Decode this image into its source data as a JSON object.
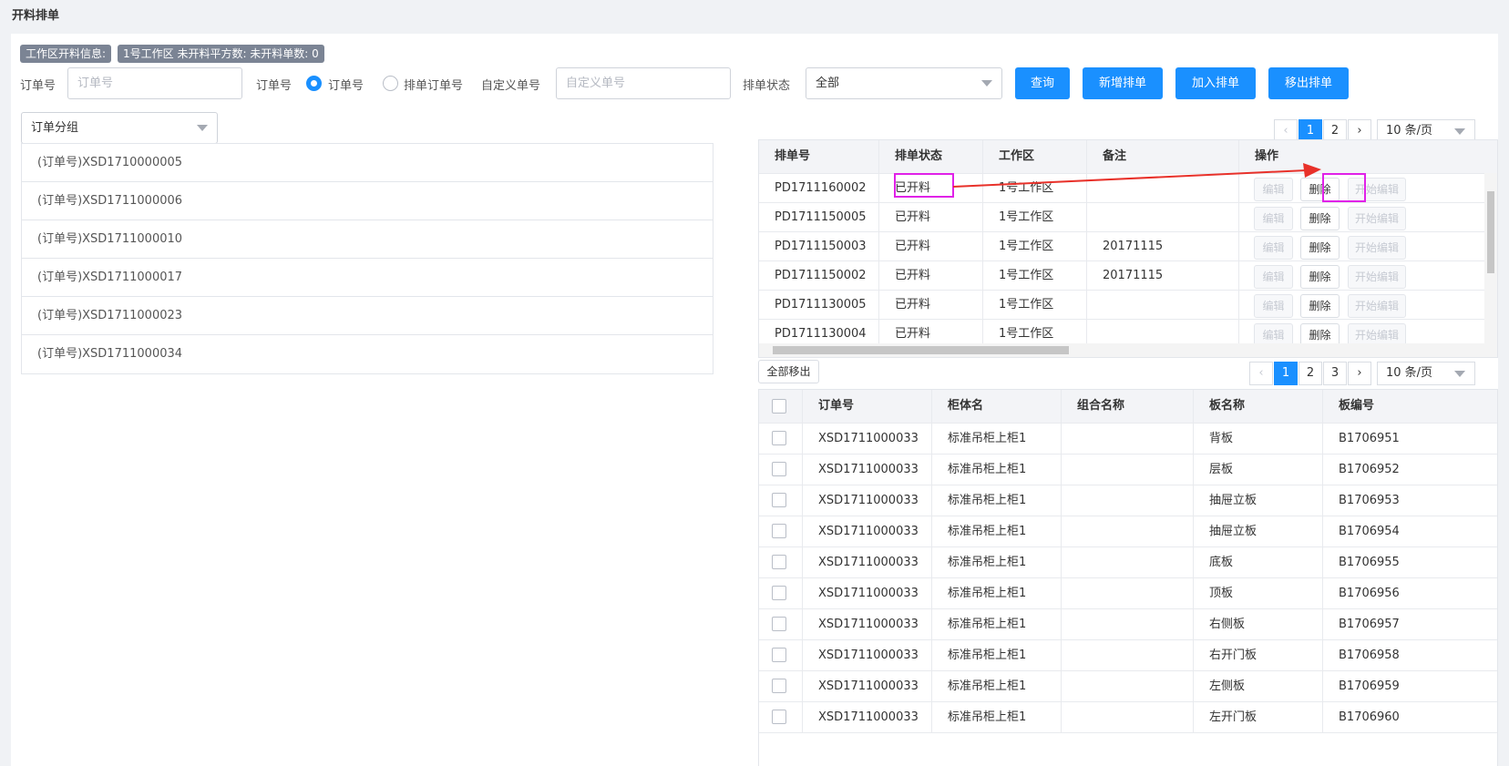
{
  "page": {
    "title": "开料排单"
  },
  "info": {
    "label": "工作区开料信息:",
    "summary": "1号工作区 未开料平方数: 未开料单数: 0"
  },
  "filters": {
    "order_label": "订单号",
    "order_placeholder": "订单号",
    "type_label": "订单号",
    "radio_order": "订单号",
    "radio_schedule": "排单订单号",
    "custom_label": "自定义单号",
    "custom_placeholder": "自定义单号",
    "status_label": "排单状态",
    "status_value": "全部",
    "group_value": "订单分组"
  },
  "buttons": {
    "query": "查询",
    "new_schedule": "新增排单",
    "add": "加入排单",
    "remove": "移出排单",
    "remove_all": "全部移出"
  },
  "orders": [
    "(订单号)XSD1710000005",
    "(订单号)XSD1711000006",
    "(订单号)XSD1711000010",
    "(订单号)XSD1711000017",
    "(订单号)XSD1711000023",
    "(订单号)XSD1711000034"
  ],
  "pager_top": {
    "prev": "‹",
    "pages": [
      "1",
      "2"
    ],
    "next": "›",
    "size": "10 条/页"
  },
  "pager_bottom": {
    "prev": "‹",
    "pages": [
      "1",
      "2",
      "3"
    ],
    "next": "›",
    "size": "10 条/页"
  },
  "schedule_table": {
    "headers": [
      "排单号",
      "排单状态",
      "工作区",
      "备注",
      "操作"
    ],
    "actions": {
      "edit": "编辑",
      "delete": "删除",
      "start_edit": "开始编辑"
    },
    "rows": [
      {
        "id": "PD1711160002",
        "status": "已开料",
        "area": "1号工作区",
        "note": ""
      },
      {
        "id": "PD1711150005",
        "status": "已开料",
        "area": "1号工作区",
        "note": ""
      },
      {
        "id": "PD1711150003",
        "status": "已开料",
        "area": "1号工作区",
        "note": "20171115"
      },
      {
        "id": "PD1711150002",
        "status": "已开料",
        "area": "1号工作区",
        "note": "20171115"
      },
      {
        "id": "PD1711130005",
        "status": "已开料",
        "area": "1号工作区",
        "note": ""
      },
      {
        "id": "PD1711130004",
        "status": "已开料",
        "area": "1号工作区",
        "note": ""
      }
    ]
  },
  "board_table": {
    "headers": [
      "订单号",
      "柜体名",
      "组合名称",
      "板名称",
      "板编号"
    ],
    "rows": [
      {
        "order": "XSD1711000033",
        "cabinet": "标准吊柜上柜1",
        "combo": "",
        "board": "背板",
        "code": "B1706951"
      },
      {
        "order": "XSD1711000033",
        "cabinet": "标准吊柜上柜1",
        "combo": "",
        "board": "层板",
        "code": "B1706952"
      },
      {
        "order": "XSD1711000033",
        "cabinet": "标准吊柜上柜1",
        "combo": "",
        "board": "抽屉立板",
        "code": "B1706953"
      },
      {
        "order": "XSD1711000033",
        "cabinet": "标准吊柜上柜1",
        "combo": "",
        "board": "抽屉立板",
        "code": "B1706954"
      },
      {
        "order": "XSD1711000033",
        "cabinet": "标准吊柜上柜1",
        "combo": "",
        "board": "底板",
        "code": "B1706955"
      },
      {
        "order": "XSD1711000033",
        "cabinet": "标准吊柜上柜1",
        "combo": "",
        "board": "顶板",
        "code": "B1706956"
      },
      {
        "order": "XSD1711000033",
        "cabinet": "标准吊柜上柜1",
        "combo": "",
        "board": "右侧板",
        "code": "B1706957"
      },
      {
        "order": "XSD1711000033",
        "cabinet": "标准吊柜上柜1",
        "combo": "",
        "board": "右开门板",
        "code": "B1706958"
      },
      {
        "order": "XSD1711000033",
        "cabinet": "标准吊柜上柜1",
        "combo": "",
        "board": "左侧板",
        "code": "B1706959"
      },
      {
        "order": "XSD1711000033",
        "cabinet": "标准吊柜上柜1",
        "combo": "",
        "board": "左开门板",
        "code": "B1706960"
      }
    ]
  },
  "colors": {
    "primary": "#1a90ff",
    "highlight": "#e021e8",
    "arrow": "#e8312a"
  }
}
